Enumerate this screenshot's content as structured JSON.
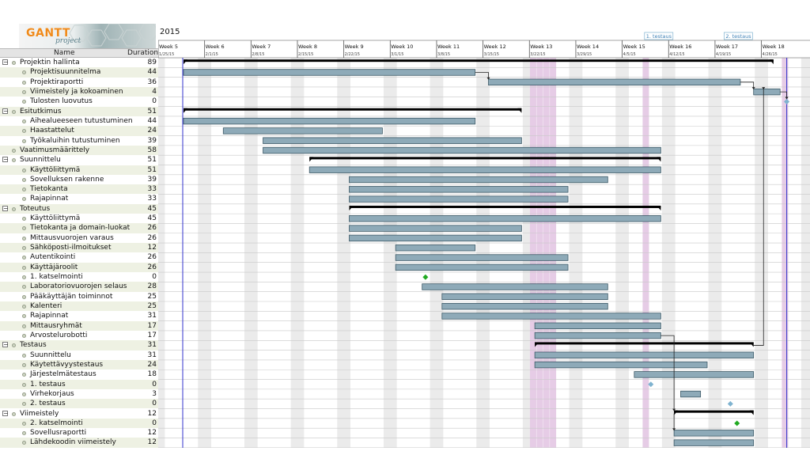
{
  "logo": {
    "title": "GANTT",
    "subtitle": "project"
  },
  "table_header": {
    "name": "Name",
    "duration": "Duration"
  },
  "timeline": {
    "year": "2015",
    "weeks": [
      {
        "label": "Week 5",
        "date": "1/25/15"
      },
      {
        "label": "Week 6",
        "date": "2/1/15"
      },
      {
        "label": "Week 7",
        "date": "2/8/15"
      },
      {
        "label": "Week 8",
        "date": "2/15/15"
      },
      {
        "label": "Week 9",
        "date": "2/22/15"
      },
      {
        "label": "Week 10",
        "date": "3/1/15"
      },
      {
        "label": "Week 11",
        "date": "3/8/15"
      },
      {
        "label": "Week 12",
        "date": "3/15/15"
      },
      {
        "label": "Week 13",
        "date": "3/22/15"
      },
      {
        "label": "Week 14",
        "date": "3/29/15"
      },
      {
        "label": "Week 15",
        "date": "4/5/15"
      },
      {
        "label": "Week 16",
        "date": "4/12/15"
      },
      {
        "label": "Week 17",
        "date": "4/19/15"
      },
      {
        "label": "Week 18",
        "date": "4/26/15"
      }
    ],
    "flags": [
      "1. testaus",
      "2. testaus"
    ],
    "holiday_days": [
      52.5,
      53.5,
      54.5,
      55.5,
      69.5,
      90.5
    ]
  },
  "colors": {
    "bar_fill": "#8eaab8",
    "bar_stroke": "#3d5966",
    "summary": "#000000",
    "milestone": "#22aa22",
    "milestone_alt": "#7fb3d0",
    "today_line": "#3333cc",
    "holiday": "#e6cce6",
    "weekend": "#ebebeb",
    "row_alt": "#eef1e3"
  },
  "tasks": [
    {
      "name": "Projektin hallinta",
      "duration": "89",
      "level": 0,
      "type": "summary",
      "start": 0,
      "end": 89
    },
    {
      "name": "Projektisuunnitelma",
      "duration": "44",
      "level": 1,
      "type": "task",
      "start": 0,
      "end": 44
    },
    {
      "name": "Projektiraportti",
      "duration": "36",
      "level": 1,
      "type": "task",
      "start": 46,
      "end": 84
    },
    {
      "name": "Viimeistely ja kokoaminen",
      "duration": "4",
      "level": 1,
      "type": "task",
      "start": 86,
      "end": 90
    },
    {
      "name": "Tulosten luovutus",
      "duration": "0",
      "level": 1,
      "type": "milestone",
      "start": 91,
      "milestone_color": "alt"
    },
    {
      "name": "Esitutkimus",
      "duration": "51",
      "level": 0,
      "type": "summary",
      "start": 0,
      "end": 51
    },
    {
      "name": "Aihealueeseen tutustuminen",
      "duration": "44",
      "level": 1,
      "type": "task",
      "start": 0,
      "end": 44
    },
    {
      "name": "Haastattelut",
      "duration": "24",
      "level": 1,
      "type": "task",
      "start": 6,
      "end": 30
    },
    {
      "name": "Työkaluihin tutustuminen",
      "duration": "39",
      "level": 1,
      "type": "task",
      "start": 12,
      "end": 51
    },
    {
      "name": "Vaatimusmäärittely",
      "duration": "58",
      "level": 0,
      "type": "task",
      "start": 12,
      "end": 72
    },
    {
      "name": "Suunnittelu",
      "duration": "51",
      "level": 0,
      "type": "summary",
      "start": 19,
      "end": 72
    },
    {
      "name": "Käyttöliittymä",
      "duration": "51",
      "level": 1,
      "type": "task",
      "start": 19,
      "end": 72
    },
    {
      "name": "Sovelluksen rakenne",
      "duration": "39",
      "level": 1,
      "type": "task",
      "start": 25,
      "end": 64
    },
    {
      "name": "Tietokanta",
      "duration": "33",
      "level": 1,
      "type": "task",
      "start": 25,
      "end": 58
    },
    {
      "name": "Rajapinnat",
      "duration": "33",
      "level": 1,
      "type": "task",
      "start": 25,
      "end": 58
    },
    {
      "name": "Toteutus",
      "duration": "45",
      "level": 0,
      "type": "summary",
      "start": 25,
      "end": 72
    },
    {
      "name": "Käyttöliittymä",
      "duration": "45",
      "level": 1,
      "type": "task",
      "start": 25,
      "end": 72
    },
    {
      "name": "Tietokanta ja domain-luokat",
      "duration": "26",
      "level": 1,
      "type": "task",
      "start": 25,
      "end": 51
    },
    {
      "name": "Mittausvuorojen varaus",
      "duration": "26",
      "level": 1,
      "type": "task",
      "start": 25,
      "end": 51
    },
    {
      "name": "Sähköposti-ilmoitukset",
      "duration": "12",
      "level": 1,
      "type": "task",
      "start": 32,
      "end": 44
    },
    {
      "name": "Autentikointi",
      "duration": "26",
      "level": 1,
      "type": "task",
      "start": 32,
      "end": 58
    },
    {
      "name": "Käyttäjäroolit",
      "duration": "26",
      "level": 1,
      "type": "task",
      "start": 32,
      "end": 58
    },
    {
      "name": "1. katselmointi",
      "duration": "0",
      "level": 1,
      "type": "milestone",
      "start": 36.5,
      "milestone_color": "green"
    },
    {
      "name": "Laboratoriovuorojen selaus",
      "duration": "28",
      "level": 1,
      "type": "task",
      "start": 36,
      "end": 64
    },
    {
      "name": "Pääkäyttäjän toiminnot",
      "duration": "25",
      "level": 1,
      "type": "task",
      "start": 39,
      "end": 64
    },
    {
      "name": "Kalenteri",
      "duration": "25",
      "level": 1,
      "type": "task",
      "start": 39,
      "end": 64
    },
    {
      "name": "Rajapinnat",
      "duration": "31",
      "level": 1,
      "type": "task",
      "start": 39,
      "end": 72
    },
    {
      "name": "Mittausryhmät",
      "duration": "17",
      "level": 1,
      "type": "task",
      "start": 53,
      "end": 72
    },
    {
      "name": "Arvostelurobotti",
      "duration": "17",
      "level": 1,
      "type": "task",
      "start": 53,
      "end": 72
    },
    {
      "name": "Testaus",
      "duration": "31",
      "level": 0,
      "type": "summary",
      "start": 53,
      "end": 86
    },
    {
      "name": "Suunnittelu",
      "duration": "31",
      "level": 1,
      "type": "task",
      "start": 53,
      "end": 86
    },
    {
      "name": "Käytettävyystestaus",
      "duration": "24",
      "level": 1,
      "type": "task",
      "start": 53,
      "end": 79
    },
    {
      "name": "Järjestelmätestaus",
      "duration": "18",
      "level": 1,
      "type": "task",
      "start": 68,
      "end": 86
    },
    {
      "name": "1. testaus",
      "duration": "0",
      "level": 1,
      "type": "milestone",
      "start": 70.5,
      "milestone_color": "alt"
    },
    {
      "name": "Virhekorjaus",
      "duration": "3",
      "level": 1,
      "type": "task",
      "start": 75,
      "end": 78
    },
    {
      "name": "2. testaus",
      "duration": "0",
      "level": 1,
      "type": "milestone",
      "start": 82.5,
      "milestone_color": "alt"
    },
    {
      "name": "Viimeistely",
      "duration": "12",
      "level": 0,
      "type": "summary",
      "start": 74,
      "end": 86
    },
    {
      "name": "2. katselmointi",
      "duration": "0",
      "level": 1,
      "type": "milestone",
      "start": 83.5,
      "milestone_color": "green"
    },
    {
      "name": "Sovellusraportti",
      "duration": "12",
      "level": 1,
      "type": "task",
      "start": 74,
      "end": 86
    },
    {
      "name": "Lähdekoodin viimeistely",
      "duration": "12",
      "level": 1,
      "type": "task",
      "start": 74,
      "end": 86
    }
  ]
}
